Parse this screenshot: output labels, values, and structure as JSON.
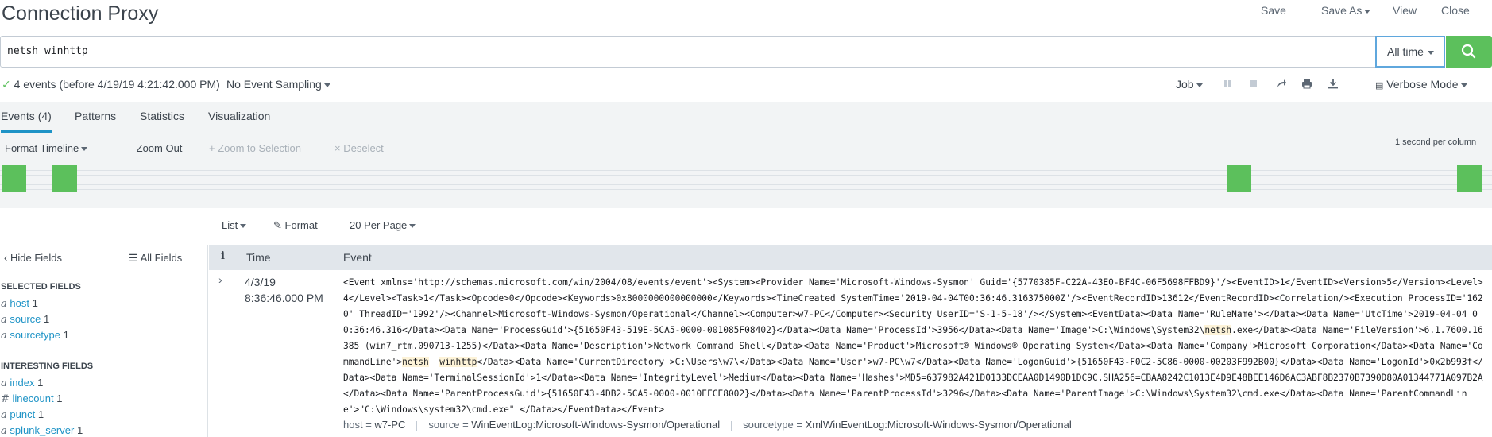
{
  "header": {
    "title": "Connection Proxy",
    "actions": {
      "save": "Save",
      "save_as": "Save As",
      "view": "View",
      "close": "Close"
    }
  },
  "search": {
    "query": "netsh winhttp",
    "time_range": "All time"
  },
  "status": {
    "events_summary": "4 events (before 4/19/19 4:21:42.000 PM)",
    "sampling": "No Event Sampling",
    "job": "Job",
    "mode": "Verbose Mode"
  },
  "tabs": [
    {
      "label": "Events (4)"
    },
    {
      "label": "Patterns"
    },
    {
      "label": "Statistics"
    },
    {
      "label": "Visualization"
    }
  ],
  "timeline": {
    "format": "Format Timeline",
    "zoom_out": "Zoom Out",
    "zoom_selection": "Zoom to Selection",
    "deselect": "Deselect",
    "scale": "1 second per column"
  },
  "results_toolbar": {
    "list": "List",
    "format": "Format",
    "per_page": "20 Per Page"
  },
  "sidebar": {
    "hide_fields": "Hide Fields",
    "all_fields": "All Fields",
    "selected_heading": "SELECTED FIELDS",
    "selected": [
      {
        "type": "a",
        "name": "host",
        "count": "1"
      },
      {
        "type": "a",
        "name": "source",
        "count": "1"
      },
      {
        "type": "a",
        "name": "sourcetype",
        "count": "1"
      }
    ],
    "interesting_heading": "INTERESTING FIELDS",
    "interesting": [
      {
        "type": "a",
        "name": "index",
        "count": "1"
      },
      {
        "type": "#",
        "name": "linecount",
        "count": "1"
      },
      {
        "type": "a",
        "name": "punct",
        "count": "1"
      },
      {
        "type": "a",
        "name": "splunk_server",
        "count": "1"
      }
    ]
  },
  "table": {
    "col_info": "i",
    "col_time": "Time",
    "col_event": "Event"
  },
  "event": {
    "date": "4/3/19",
    "time": "8:36:46.000 PM",
    "raw_1": "<Event xmlns='http://schemas.microsoft.com/win/2004/08/events/event'><System><Provider Name='Microsoft-Windows-Sysmon' Guid='{5770385F-C22A-43E0-BF4C-06F5698FFBD9}'/><EventID>1</EventID><Version>5</Version><Level>4</Level><Task>1</Task><Opcode>0</Opcode><Keywords>0x8000000000000000</Keywords><TimeCreated SystemTime='2019-04-04T00:36:46.316375000Z'/><EventRecordID>13612</EventRecordID><Correlation/><Execution ProcessID='1620' ThreadID='1992'/><Channel>Microsoft-Windows-Sysmon/Operational</Channel><Computer>w7-PC</Computer><Security UserID='S-1-5-18'/></System><EventData><Data Name='RuleName'></Data><Data Name='UtcTime'>2019-04-04 00:36:46.316</Data><Data Name='ProcessGuid'>{51650F43-519E-5CA5-0000-001085F08402}</Data><Data Name='ProcessId'>3956</Data><Data Name='Image'>C:\\Windows\\System32\\",
    "hl_1": "netsh",
    "raw_2": ".exe</Data><Data Name='FileVersion'>6.1.7600.16385 (win7_rtm.090713-1255)</Data><Data Name='Description'>Network Command Shell</Data><Data Name='Product'>Microsoft® Windows® Operating System</Data><Data Name='Company'>Microsoft Corporation</Data><Data Name='CommandLine'>",
    "hl_2": "netsh",
    "hl_3": "winhttp",
    "raw_3": "</Data><Data Name='CurrentDirectory'>C:\\Users\\w7\\</Data><Data Name='User'>w7-PC\\w7</Data><Data Name='LogonGuid'>{51650F43-F0C2-5C86-0000-00203F992B00}</Data><Data Name='LogonId'>0x2b993f</Data><Data Name='TerminalSessionId'>1</Data><Data Name='IntegrityLevel'>Medium</Data><Data Name='Hashes'>MD5=637982A421D0133DCEAA0D1490D1DC9C,SHA256=CBAA8242C1013E4D9E48BEE146D6AC3ABF8B2370B7390D80A01344771A097B2A</Data><Data Name='ParentProcessGuid'>{51650F43-4DB2-5CA5-0000-0010EFCE8002}</Data><Data Name='ParentProcessId'>3296</Data><Data Name='ParentImage'>C:\\Windows\\System32\\cmd.exe</Data><Data Name='ParentCommandLine'>\"C:\\Windows\\system32\\cmd.exe\" </Data></EventData></Event>",
    "meta": [
      {
        "key": "host",
        "value": "w7-PC"
      },
      {
        "key": "source",
        "value": "WinEventLog:Microsoft-Windows-Sysmon/Operational"
      },
      {
        "key": "sourcetype",
        "value": "XmlWinEventLog:Microsoft-Windows-Sysmon/Operational"
      }
    ]
  },
  "colors": {
    "accent_green": "#5cc05c",
    "link_blue": "#1e93c6",
    "highlight": "#fdf3d8"
  }
}
